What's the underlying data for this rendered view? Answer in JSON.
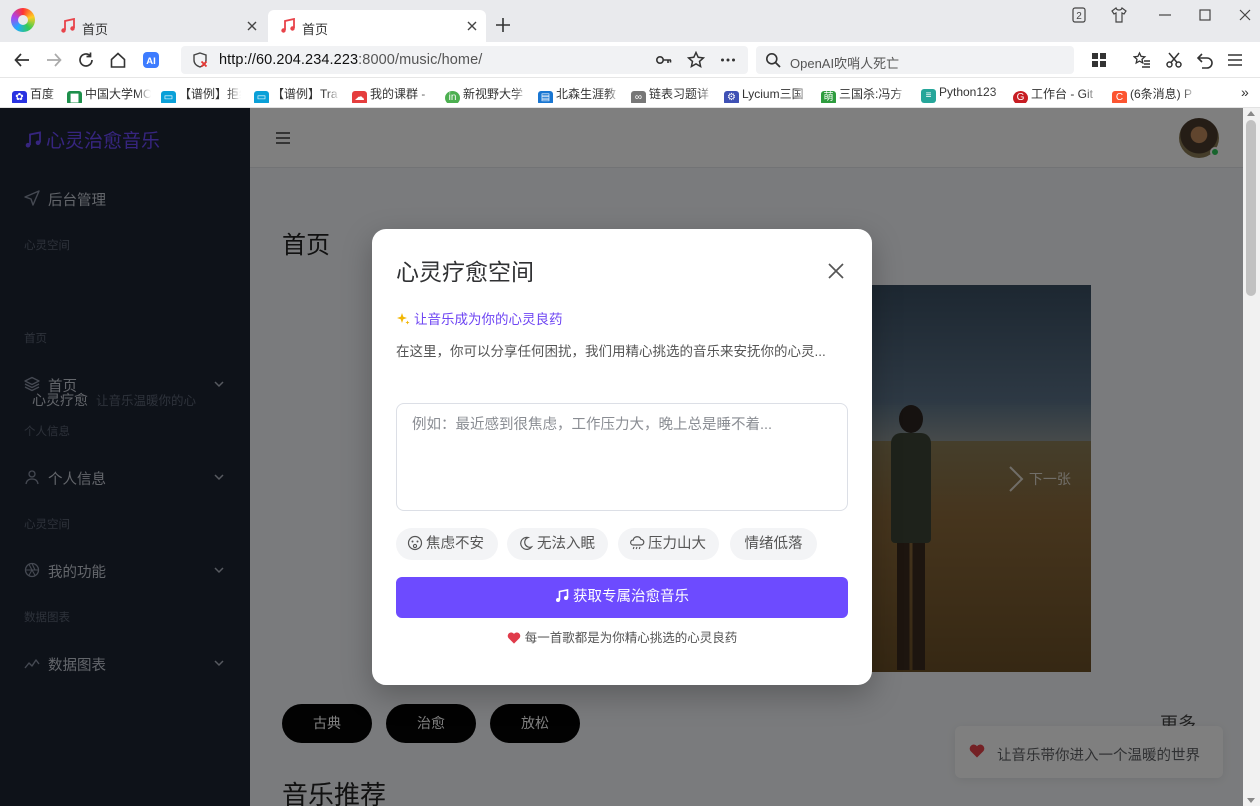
{
  "browser": {
    "tabs": [
      {
        "title": "首页",
        "active": false
      },
      {
        "title": "首页",
        "active": true
      }
    ],
    "tab_count_badge": "2",
    "address": {
      "host": "http://60.204.234.223",
      "rest": ":8000/music/home/"
    },
    "search_text": "OpenAI吹哨人死亡",
    "bookmarks": [
      {
        "label": "百度",
        "icon": "paw-icon",
        "color": "#2932e1"
      },
      {
        "label": "中国大学MOOC",
        "icon": "book-icon",
        "color": "#1d8f4b"
      },
      {
        "label": "【谱例】拒绝",
        "icon": "bilibili-icon",
        "color": "#0aa0d8"
      },
      {
        "label": "【谱例】Tra",
        "icon": "bilibili-icon",
        "color": "#0aa0d8"
      },
      {
        "label": "我的课群 -",
        "icon": "cloud-icon",
        "color": "#e53e3e"
      },
      {
        "label": "新视野大学",
        "icon": "globe-icon",
        "color": "#4caf50"
      },
      {
        "label": "北森生涯教",
        "icon": "doc-icon",
        "color": "#1976d2"
      },
      {
        "label": "链表习题详",
        "icon": "copy-icon",
        "color": "#777777"
      },
      {
        "label": "Lycium三国",
        "icon": "gear-icon",
        "color": "#3f51b5"
      },
      {
        "label": "三国杀:冯方",
        "icon": "cute-icon",
        "color": "#2e9c3e"
      },
      {
        "label": "Python123",
        "icon": "python-icon",
        "color": "#26a69a"
      },
      {
        "label": "工作台 - Git",
        "icon": "gitee-icon",
        "color": "#c71d23"
      },
      {
        "label": "(6条消息) P",
        "icon": "csdn-icon",
        "color": "#fc5531"
      }
    ]
  },
  "sidebar": {
    "brand": "心灵治愈音乐",
    "admin": "后台管理",
    "sections": [
      "心灵空间",
      "首页",
      "个人信息",
      "心灵空间",
      "数据图表"
    ],
    "sub_item": {
      "label": "心灵疗愈",
      "hint": "让音乐温暖你的心"
    },
    "items": [
      {
        "label": "首页",
        "icon": "layers-icon"
      },
      {
        "label": "个人信息",
        "icon": "user-icon"
      },
      {
        "label": "我的功能",
        "icon": "aperture-icon"
      },
      {
        "label": "数据图表",
        "icon": "chart-icon"
      }
    ]
  },
  "page": {
    "title": "首页",
    "carousel_next": "下一张",
    "categories": [
      "古典",
      "治愈",
      "放松"
    ],
    "more": "更多",
    "section_title": "音乐推荐",
    "toast": "让音乐带你进入一个温暖的世界"
  },
  "dialog": {
    "title": "心灵疗愈空间",
    "subtitle": "让音乐成为你的心灵良药",
    "description": "在这里，你可以分享任何困扰，我们用精心挑选的音乐来安抚你的心灵...",
    "placeholder": "例如：最近感到很焦虑，工作压力大，晚上总是睡不着...",
    "moods": [
      {
        "label": "焦虑不安",
        "icon": "worried-face-icon"
      },
      {
        "label": "无法入眠",
        "icon": "moon-icon"
      },
      {
        "label": "压力山大",
        "icon": "rain-cloud-icon"
      },
      {
        "label": "情绪低落",
        "icon": ""
      }
    ],
    "submit": "获取专属治愈音乐",
    "footer": "每一首歌都是为你精心挑选的心灵良药"
  },
  "colors": {
    "accent": "#6d4bff",
    "sidebar_bg": "#1d2433",
    "chip_bg": "#050505"
  }
}
